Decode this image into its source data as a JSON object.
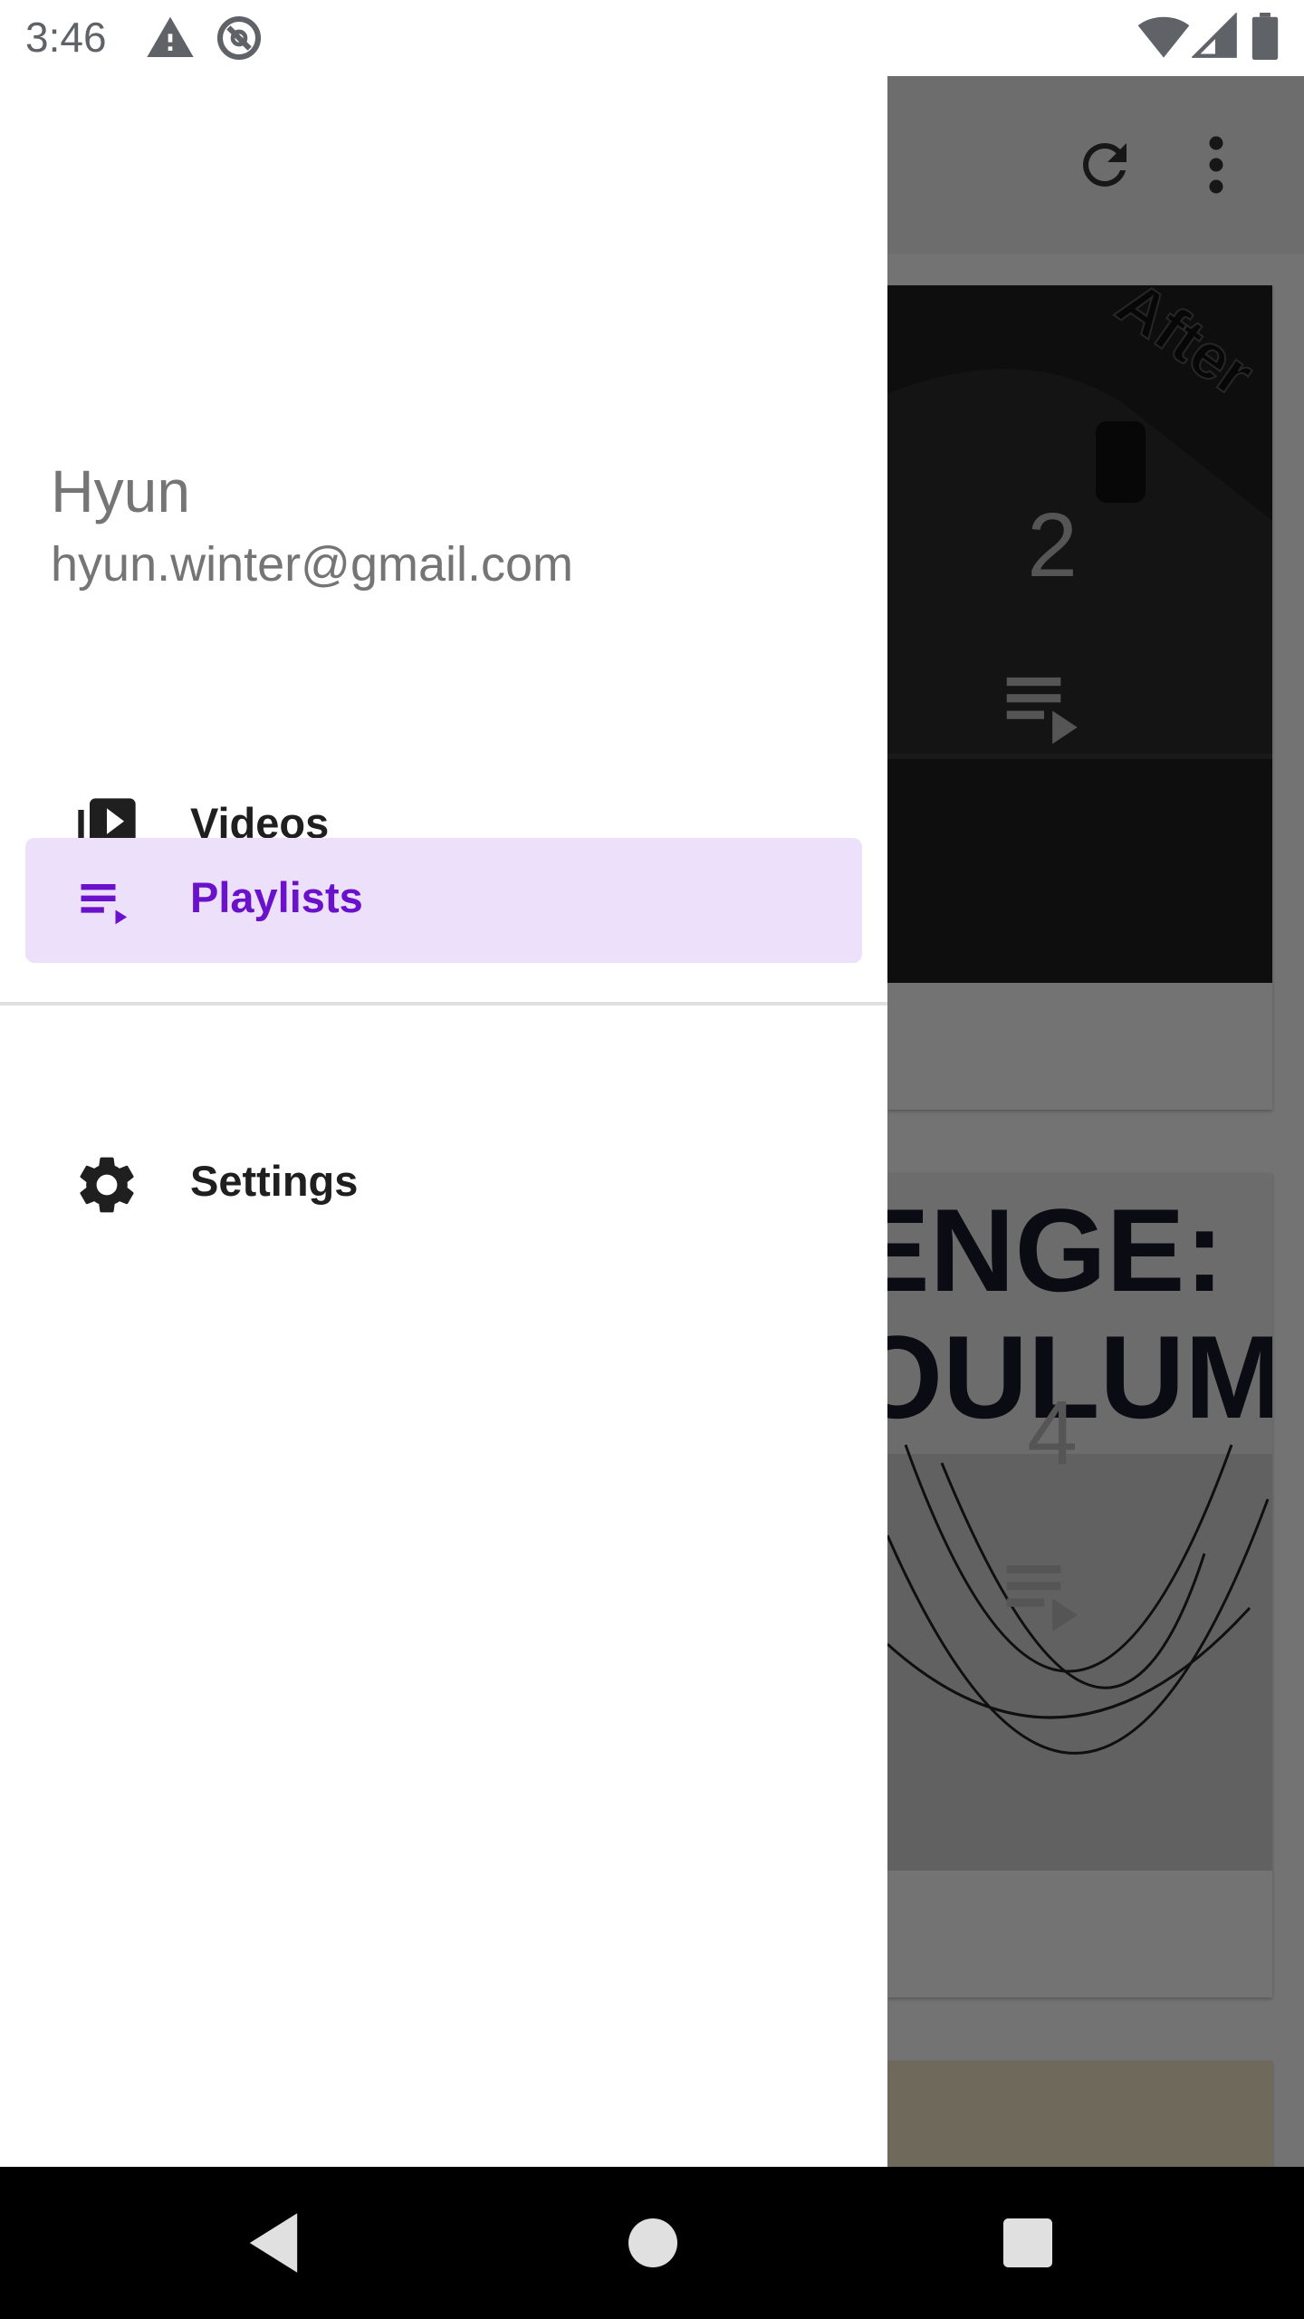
{
  "status_bar": {
    "time": "3:46",
    "icons": [
      "warning-icon",
      "sync-disabled-icon",
      "wifi-icon",
      "signal-icon",
      "battery-icon"
    ]
  },
  "drawer": {
    "account": {
      "name": "Hyun",
      "email": "hyun.winter@gmail.com"
    },
    "items": [
      {
        "label": "Videos",
        "icon": "video-library-icon",
        "selected": false
      },
      {
        "label": "Playlists",
        "icon": "playlist-play-icon",
        "selected": true
      },
      {
        "label": "Settings",
        "icon": "gear-icon",
        "selected": false
      }
    ]
  },
  "background": {
    "toolbar_icons": [
      "refresh-icon",
      "more-vert-icon"
    ],
    "cards": [
      {
        "count": "2"
      },
      {
        "count": "4"
      }
    ]
  },
  "system_nav": {
    "buttons": [
      "back-icon",
      "home-icon",
      "recents-icon"
    ]
  },
  "colors": {
    "accent": "#6a11cb",
    "selected_bg": "#ede0fa"
  }
}
